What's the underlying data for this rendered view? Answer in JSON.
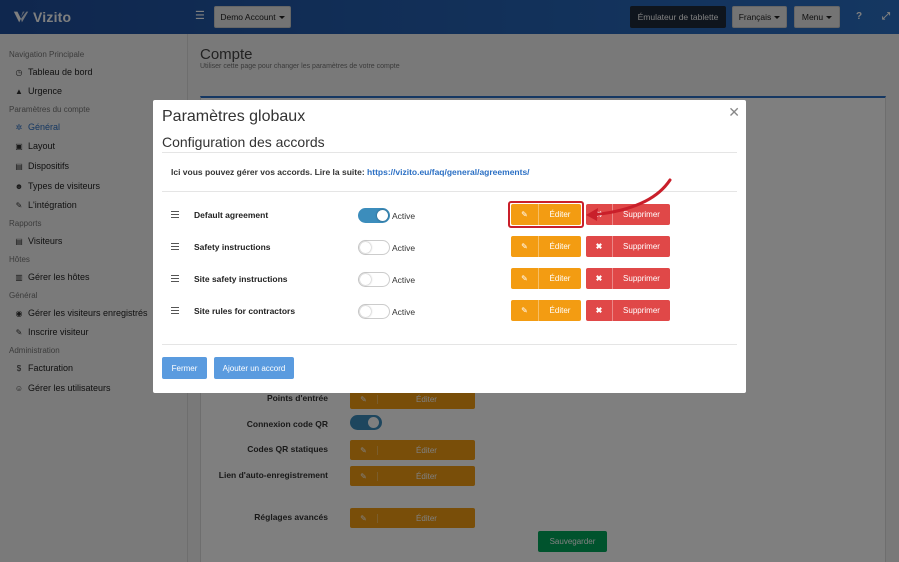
{
  "app": {
    "name": "Vizito"
  },
  "topbar": {
    "account_label": "Demo Account",
    "tablet_label": "Émulateur de tablette",
    "language_label": "Français",
    "menu_label": "Menu",
    "help_icon": "question-icon",
    "expand_icon": "expand-icon"
  },
  "sidebar": {
    "sections": [
      {
        "title": "Navigation Principale",
        "items": [
          {
            "label": "Tableau de bord",
            "icon": "dashboard-icon"
          },
          {
            "label": "Urgence",
            "icon": "warning-icon"
          }
        ]
      },
      {
        "title": "Paramètres du compte",
        "items": [
          {
            "label": "Général",
            "icon": "gear-icon"
          },
          {
            "label": "Layout",
            "icon": "image-icon"
          },
          {
            "label": "Dispositifs",
            "icon": "tablet-icon"
          },
          {
            "label": "Types de visiteurs",
            "icon": "users-icon"
          },
          {
            "label": "L'intégration",
            "icon": "plug-icon"
          }
        ]
      },
      {
        "title": "Rapports",
        "items": [
          {
            "label": "Visiteurs",
            "icon": "list-icon"
          }
        ]
      },
      {
        "title": "Hôtes",
        "items": [
          {
            "label": "Gérer les hôtes",
            "icon": "building-icon"
          }
        ]
      },
      {
        "title": "Général",
        "items": [
          {
            "label": "Gérer les visiteurs enregistrés",
            "icon": "user-circle-icon"
          },
          {
            "label": "Inscrire visiteur",
            "icon": "pencil-icon"
          }
        ]
      },
      {
        "title": "Administration",
        "items": [
          {
            "label": "Facturation",
            "icon": "dollar-icon"
          },
          {
            "label": "Gérer les utilisateurs",
            "icon": "user-plus-icon"
          }
        ]
      }
    ]
  },
  "page": {
    "title": "Compte",
    "subtitle": "Utiliser cette page pour changer les paramètres de votre compte",
    "rows": [
      {
        "label": "Points d'entrée",
        "button": "Éditer"
      },
      {
        "label": "Connexion code QR",
        "toggle": "on"
      },
      {
        "label": "Codes QR statiques",
        "button": "Éditer"
      },
      {
        "label": "Lien d'auto-enregistrement",
        "button": "Éditer"
      },
      {
        "label": "Réglages avancés",
        "button": "Éditer"
      }
    ],
    "save_label": "Sauvegarder"
  },
  "modal": {
    "title": "Paramètres globaux",
    "subtitle": "Configuration des accords",
    "info_text": "Ici vous pouvez gérer vos accords. Lire la suite: ",
    "info_link": "https://vizito.eu/faq/general/agreements/",
    "agreements": [
      {
        "name": "Default agreement",
        "active": true,
        "status": "Active",
        "edit": "Éditer",
        "delete": "Supprimer"
      },
      {
        "name": "Safety instructions",
        "active": false,
        "status": "Active",
        "edit": "Éditer",
        "delete": "Supprimer"
      },
      {
        "name": "Site safety instructions",
        "active": false,
        "status": "Active",
        "edit": "Éditer",
        "delete": "Supprimer"
      },
      {
        "name": "Site rules for contractors",
        "active": false,
        "status": "Active",
        "edit": "Éditer",
        "delete": "Supprimer"
      }
    ],
    "close_label": "Fermer",
    "add_label": "Ajouter un accord"
  },
  "colors": {
    "brand": "#2563b5",
    "edit": "#f39c12",
    "delete": "#e04848",
    "primary": "#5a9bdf",
    "save": "#00a65a",
    "annotation": "#c91f2a"
  }
}
